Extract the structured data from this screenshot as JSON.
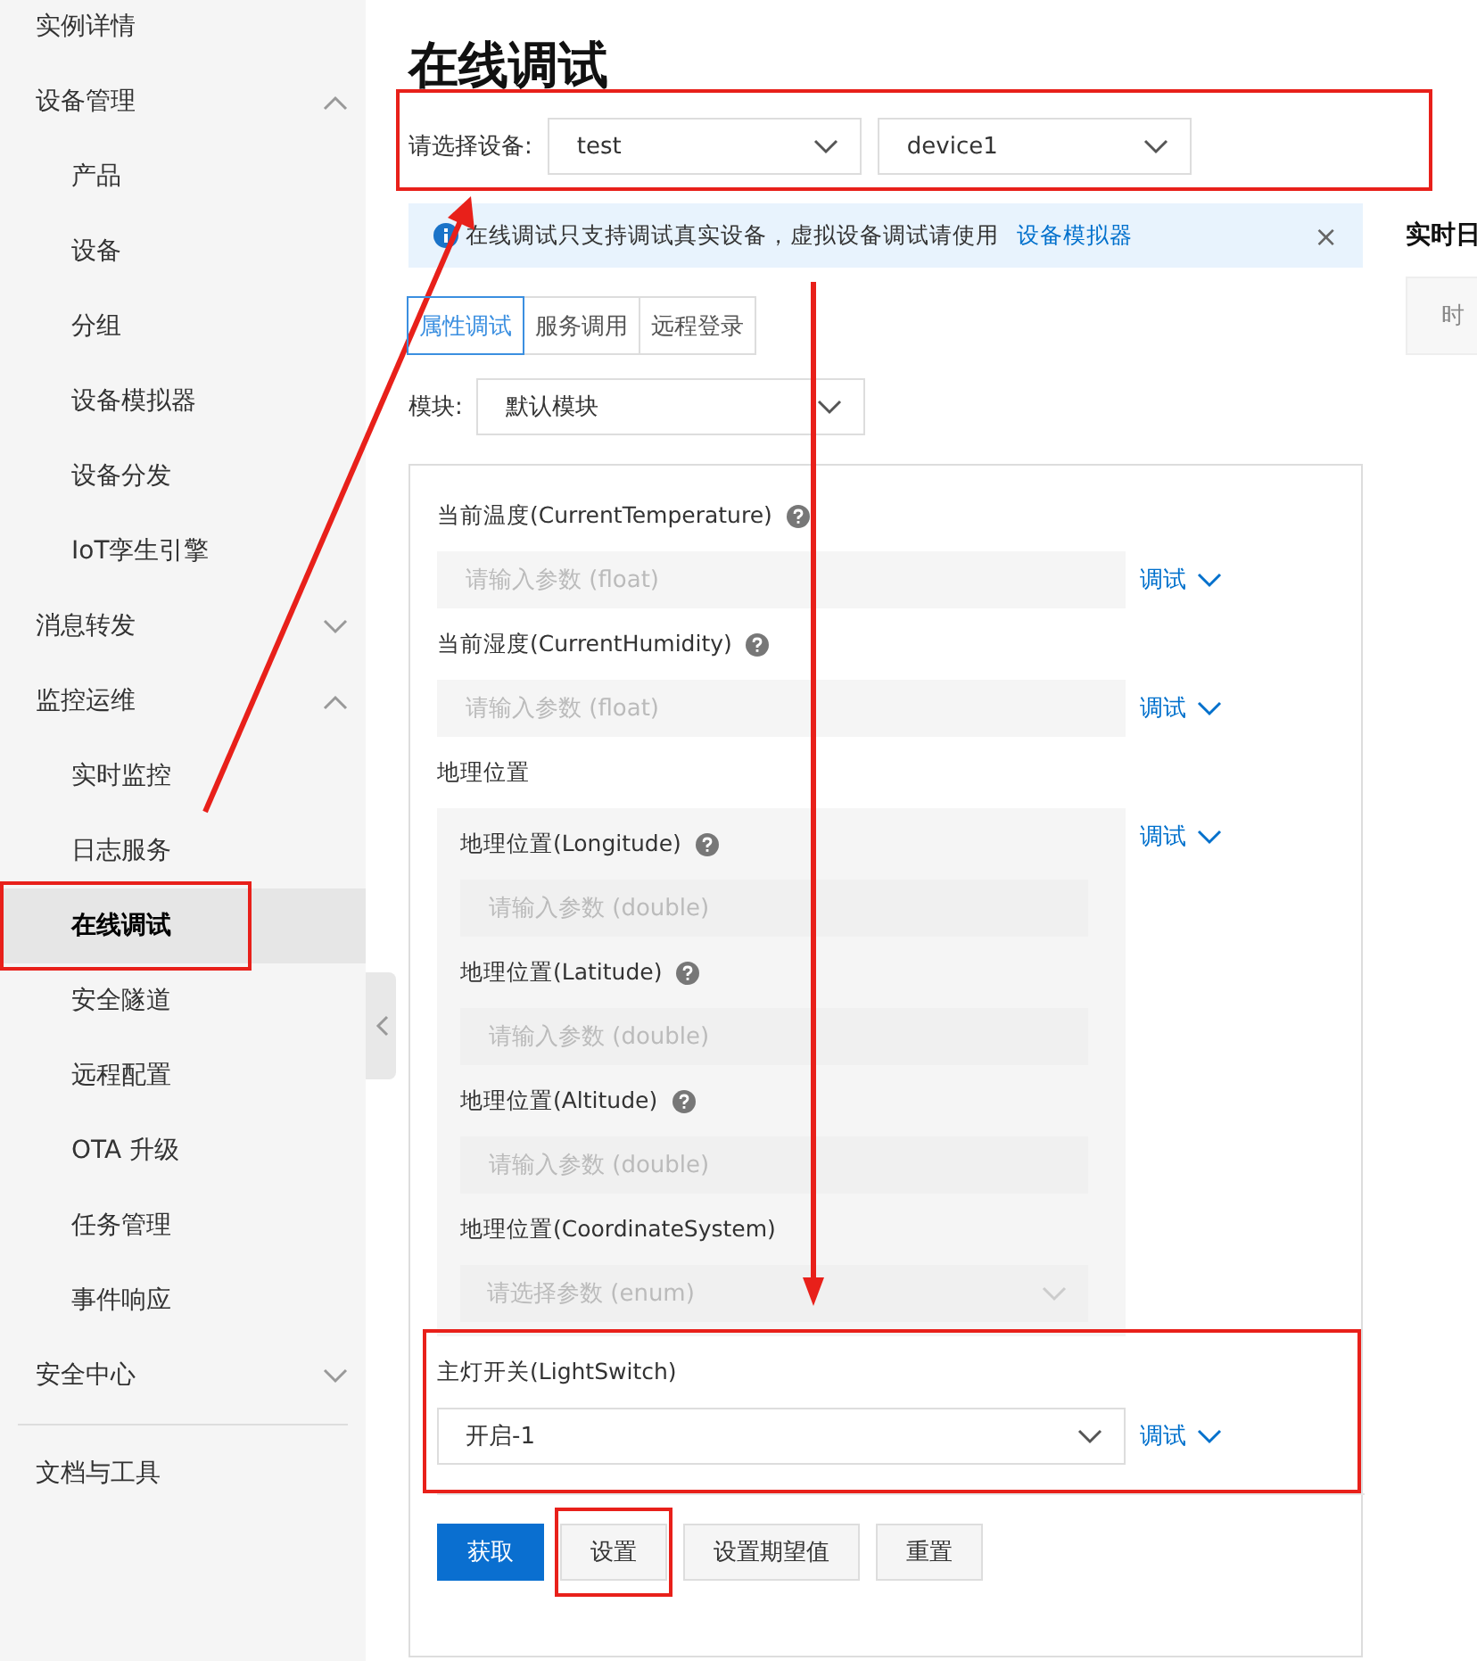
{
  "sidebar": {
    "items": [
      {
        "label": "实例详情",
        "selected": false
      },
      {
        "label": "设备管理",
        "selected": false,
        "expanded": true,
        "children": [
          {
            "label": "产品",
            "selected": false
          },
          {
            "label": "设备",
            "selected": false
          },
          {
            "label": "分组",
            "selected": false
          },
          {
            "label": "设备模拟器",
            "selected": false
          },
          {
            "label": "设备分发",
            "selected": false
          },
          {
            "label": "IoT孪生引擎",
            "selected": false
          }
        ]
      },
      {
        "label": "消息转发",
        "selected": false,
        "expanded": false
      },
      {
        "label": "监控运维",
        "selected": false,
        "expanded": true,
        "children": [
          {
            "label": "实时监控",
            "selected": false
          },
          {
            "label": "日志服务",
            "selected": false
          },
          {
            "label": "在线调试",
            "selected": true,
            "highlighted": true
          },
          {
            "label": "安全隧道",
            "selected": false
          },
          {
            "label": "远程配置",
            "selected": false
          },
          {
            "label": "OTA 升级",
            "selected": false
          },
          {
            "label": "任务管理",
            "selected": false
          },
          {
            "label": "事件响应",
            "selected": false
          }
        ]
      },
      {
        "label": "安全中心",
        "selected": false,
        "expanded": false
      }
    ],
    "footer_items": [
      {
        "label": "文档与工具",
        "selected": false
      }
    ]
  },
  "page": {
    "title": "在线调试",
    "device_picker": {
      "label": "请选择设备:",
      "highlighted": true,
      "selects": [
        {
          "value": "test"
        },
        {
          "value": "device1"
        }
      ]
    },
    "alert": {
      "text": "在线调试只支持调试真实设备，虚拟设备调试请使用",
      "link": "设备模拟器",
      "close": "×"
    },
    "tabs": [
      {
        "label": "属性调试",
        "selected": true
      },
      {
        "label": "服务调用",
        "selected": false
      },
      {
        "label": "远程登录",
        "selected": false
      }
    ],
    "module": {
      "label": "模块:",
      "value": "默认模块"
    },
    "fields": [
      {
        "kind": "input",
        "label": "当前温度(CurrentTemperature)",
        "help": true,
        "placeholder": "请输入参数 (float)",
        "action": "调试"
      },
      {
        "kind": "input",
        "label": "当前湿度(CurrentHumidity)",
        "help": true,
        "placeholder": "请输入参数 (float)",
        "action": "调试"
      },
      {
        "kind": "group",
        "label": "地理位置",
        "action": "调试",
        "children": [
          {
            "kind": "input",
            "label": "地理位置(Longitude)",
            "help": true,
            "placeholder": "请输入参数 (double)"
          },
          {
            "kind": "input",
            "label": "地理位置(Latitude)",
            "help": true,
            "placeholder": "请输入参数 (double)"
          },
          {
            "kind": "input",
            "label": "地理位置(Altitude)",
            "help": true,
            "placeholder": "请输入参数 (double)"
          },
          {
            "kind": "select",
            "label": "地理位置(CoordinateSystem)",
            "help": false,
            "placeholder": "请选择参数 (enum)"
          }
        ]
      },
      {
        "kind": "select",
        "label": "主灯开关(LightSwitch)",
        "help": false,
        "value": "开启-1",
        "action": "调试",
        "highlighted": true
      }
    ],
    "buttons": [
      {
        "label": "获取",
        "primary": true,
        "highlighted": false
      },
      {
        "label": "设置",
        "primary": false,
        "highlighted": true
      },
      {
        "label": "设置期望值",
        "primary": false,
        "highlighted": false
      },
      {
        "label": "重置",
        "primary": false,
        "highlighted": false
      }
    ]
  },
  "side_panel": {
    "title": "实时日",
    "column": "时"
  }
}
